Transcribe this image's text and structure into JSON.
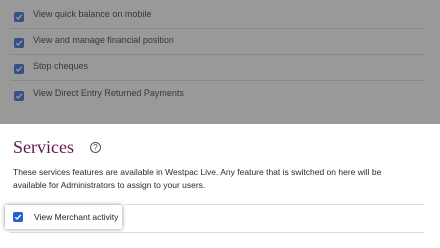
{
  "permissions": [
    {
      "label": "View quick balance on mobile",
      "checked": true
    },
    {
      "label": "View and manage financial position",
      "checked": true
    },
    {
      "label": "Stop cheques",
      "checked": true
    },
    {
      "label": "View Direct Entry Returned Payments",
      "checked": true
    }
  ],
  "services": {
    "title": "Services",
    "help_icon": "question-circle-icon",
    "help_glyph": "?",
    "description": "These services features are available in Westpac Live. Any feature that is switched on here will be available for Administrators to assign to your users.",
    "items": [
      {
        "label": "View Merchant activity",
        "checked": true
      }
    ]
  },
  "colors": {
    "checkbox": "#1f62d0",
    "title": "#621a4b",
    "overlay": "rgba(70,70,70,0.55)"
  }
}
